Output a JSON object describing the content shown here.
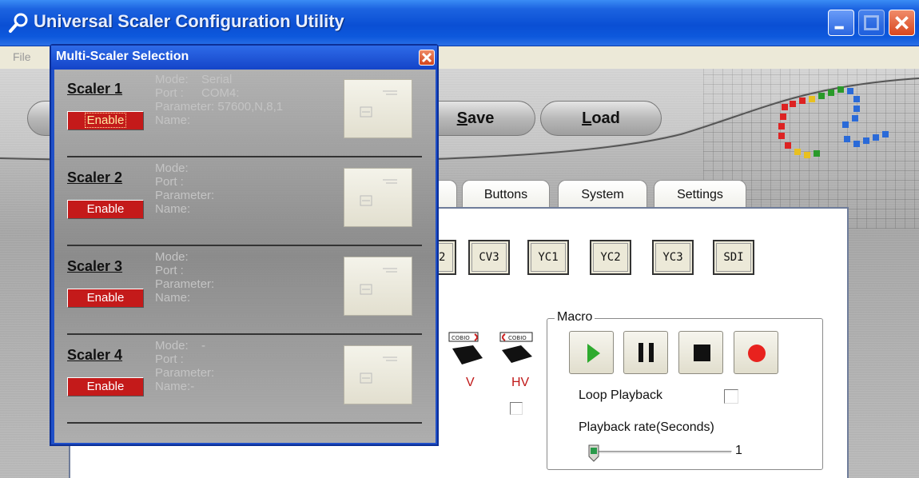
{
  "window": {
    "title": "Universal Scaler Configuration Utility",
    "menu": [
      "File"
    ]
  },
  "toolbar": {
    "save_label": "Save",
    "save_mnemonic": "S",
    "save_rest": "ave",
    "load_label": "Load",
    "load_mnemonic": "L",
    "load_rest": "oad"
  },
  "tabs": [
    {
      "label": "Buttons"
    },
    {
      "label": "System"
    },
    {
      "label": "Settings"
    }
  ],
  "sources": {
    "partial": "2",
    "items": [
      "CV3",
      "YC1",
      "YC2",
      "YC3",
      "SDI"
    ]
  },
  "flip": {
    "v_label": "V",
    "hv_label": "HV",
    "hv_checked": false
  },
  "macro": {
    "legend": "Macro",
    "loop_label": "Loop Playback",
    "loop_checked": false,
    "rate_label": "Playback rate(Seconds)",
    "rate_value": "1",
    "colors": {
      "play": "#2eaa2e",
      "record": "#e8221e"
    }
  },
  "dialog": {
    "title": "Multi-Scaler Selection",
    "scalers": [
      {
        "name": "Scaler 1",
        "enable_label": "Enable",
        "mode_label": "Mode:",
        "mode_value": "Serial",
        "port_label": "Port :",
        "port_value": "COM4:",
        "parameter_label": "Parameter:",
        "parameter_value": "57600,N,8,1",
        "name_label": "Name:",
        "name_value": ""
      },
      {
        "name": "Scaler 2",
        "enable_label": "Enable",
        "mode_label": "Mode:",
        "mode_value": "",
        "port_label": "Port :",
        "port_value": "",
        "parameter_label": "Parameter:",
        "parameter_value": "",
        "name_label": "Name:",
        "name_value": ""
      },
      {
        "name": "Scaler 3",
        "enable_label": "Enable",
        "mode_label": "Mode:",
        "mode_value": "",
        "port_label": "Port :",
        "port_value": "",
        "parameter_label": "Parameter:",
        "parameter_value": "",
        "name_label": "Name:",
        "name_value": ""
      },
      {
        "name": "Scaler 4",
        "enable_label": "Enable",
        "mode_label": "Mode:",
        "mode_value": "-",
        "port_label": "Port :",
        "port_value": "",
        "parameter_label": "Parameter:",
        "parameter_value": "",
        "name_label": "Name:",
        "name_value": "-"
      }
    ]
  },
  "colors": {
    "titlebar": "#0a4fd4",
    "enable_button": "#c41a1a",
    "flip_label": "#c01818"
  }
}
